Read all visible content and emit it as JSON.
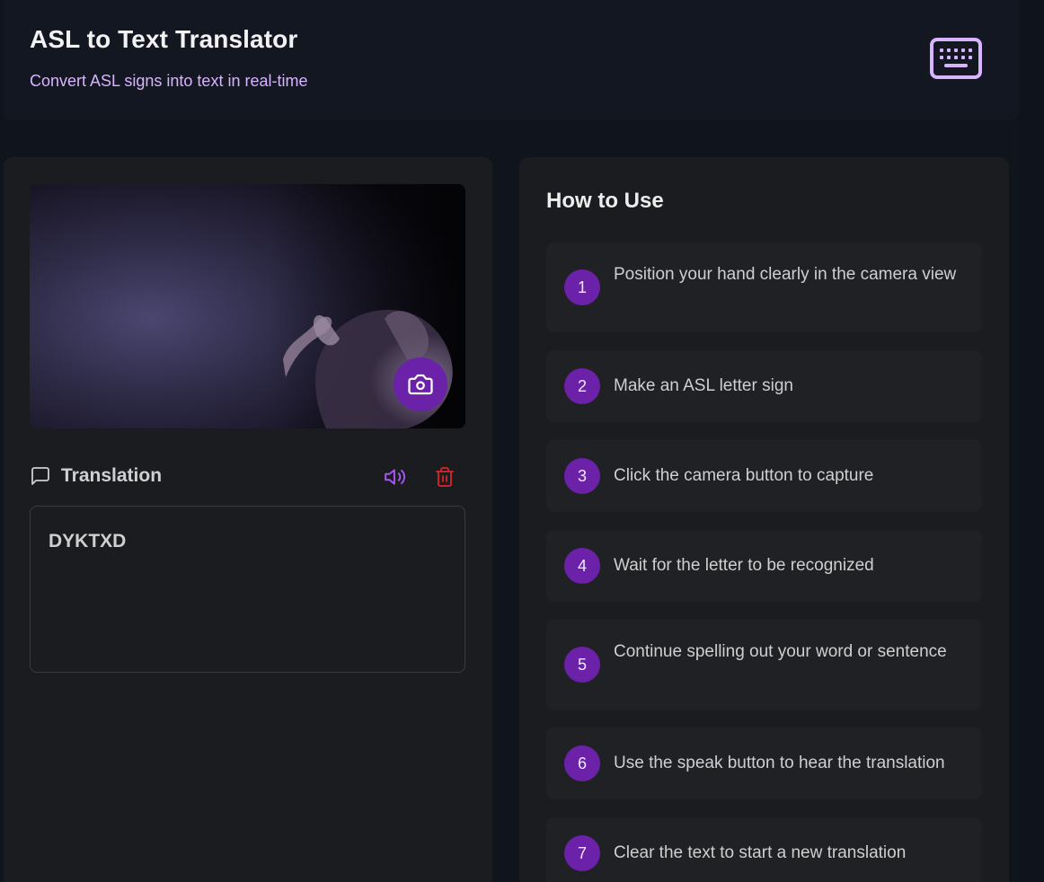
{
  "header": {
    "title": "ASL to Text Translator",
    "subtitle": "Convert ASL signs into text in real-time",
    "icon": "keyboard-icon"
  },
  "camera": {
    "capture_icon": "camera-icon"
  },
  "translation": {
    "title": "Translation",
    "icon": "message-square-icon",
    "speak_icon": "volume-icon",
    "clear_icon": "trash-icon",
    "text": "DYKTXD"
  },
  "how_to_use": {
    "title": "How to Use",
    "steps": [
      {
        "number": "1",
        "text": "Position your hand clearly in the camera view"
      },
      {
        "number": "2",
        "text": "Make an ASL letter sign"
      },
      {
        "number": "3",
        "text": "Click the camera button to capture"
      },
      {
        "number": "4",
        "text": "Wait for the letter to be recognized"
      },
      {
        "number": "5",
        "text": "Continue spelling out your word or sentence"
      },
      {
        "number": "6",
        "text": "Use the speak button to hear the translation"
      },
      {
        "number": "7",
        "text": "Clear the text to start a new translation"
      }
    ]
  },
  "colors": {
    "accent": "#6b21a8",
    "accent_light": "#d8b4fe",
    "danger": "#dc2626",
    "speak": "#a855f7",
    "panel_bg": "#1b1c1f",
    "page_bg": "#10141d"
  }
}
